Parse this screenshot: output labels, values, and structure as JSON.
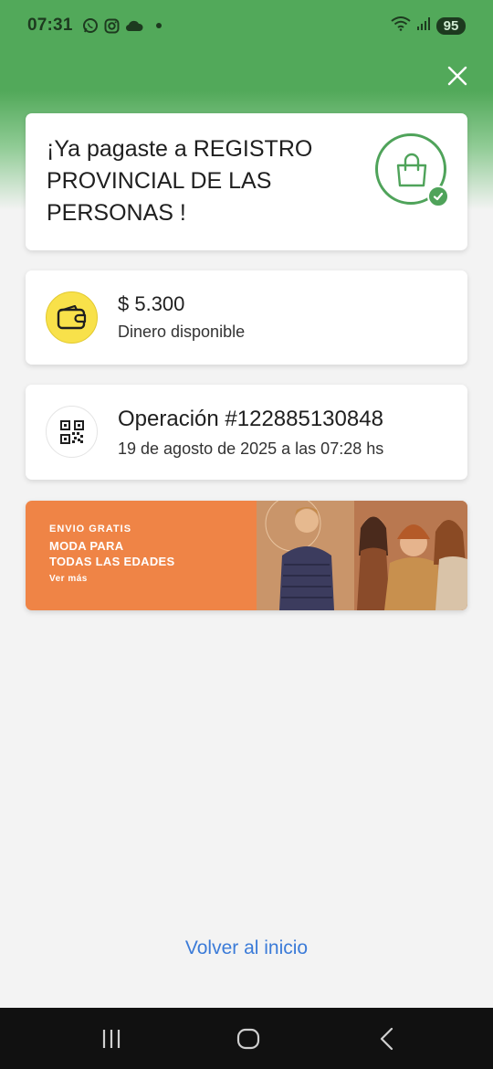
{
  "status_bar": {
    "time": "07:31",
    "battery": "95",
    "icons": [
      "whatsapp-icon",
      "instagram-icon",
      "cloud-icon",
      "wifi-icon",
      "signal-icon"
    ]
  },
  "close_icon": "close-icon",
  "payment": {
    "title": "¡Ya pagaste a  REGISTRO PROVINCIAL DE LAS PERSONAS !",
    "icon": "shopping-bag-check-icon"
  },
  "balance": {
    "amount": "$ 5.300",
    "label": "Dinero disponible",
    "icon": "wallet-icon"
  },
  "operation": {
    "title": "Operación #122885130848",
    "date": "19 de agosto de 2025 a las 07:28 hs",
    "icon": "qr-code-icon"
  },
  "banner": {
    "tag": "ENVIO GRATIS",
    "headline_1": "MODA PARA",
    "headline_2": "TODAS LAS EDADES",
    "link": "Ver más",
    "colors": {
      "background": "#ef8446"
    }
  },
  "footer": {
    "home_link": "Volver al inicio"
  },
  "nav": [
    "recent-apps-icon",
    "home-icon",
    "back-icon"
  ],
  "colors": {
    "brand_green": "#52a95a",
    "link_blue": "#3b7bd8"
  }
}
